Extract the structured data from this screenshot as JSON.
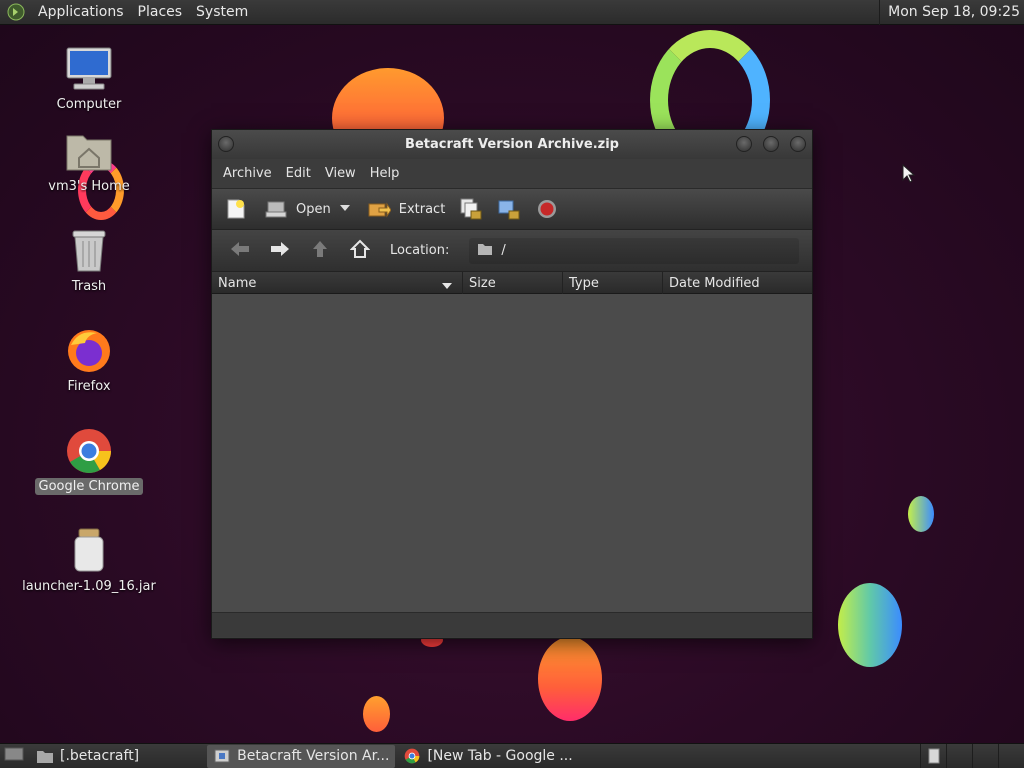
{
  "top_panel": {
    "menus": [
      "Applications",
      "Places",
      "System"
    ],
    "clock": "Mon Sep 18, 09:25"
  },
  "desktop_icons": [
    {
      "label": "Computer",
      "icon": "computer-icon"
    },
    {
      "label": "vm3's Home",
      "icon": "home-folder-icon"
    },
    {
      "label": "Trash",
      "icon": "trash-icon"
    },
    {
      "label": "Firefox",
      "icon": "firefox-icon"
    },
    {
      "label": "Google Chrome",
      "icon": "chrome-icon",
      "selected": true
    },
    {
      "label": "launcher-1.09_16.jar",
      "icon": "jar-icon"
    }
  ],
  "window": {
    "title": "Betacraft Version Archive.zip",
    "menu": [
      "Archive",
      "Edit",
      "View",
      "Help"
    ],
    "toolbar": {
      "open_label": "Open",
      "extract_label": "Extract"
    },
    "location": {
      "label": "Location:",
      "path": "/"
    },
    "columns": {
      "name": "Name",
      "size": "Size",
      "type": "Type",
      "date": "Date Modified"
    },
    "files": []
  },
  "taskbar": {
    "tasks": [
      {
        "label": "[.betacraft]",
        "icon": "folder-icon",
        "active": false
      },
      {
        "label": "Betacraft Version Ar...",
        "icon": "archive-manager-icon",
        "active": true
      },
      {
        "label": "[New Tab - Google ...",
        "icon": "chrome-icon",
        "active": false
      }
    ]
  },
  "colors": {
    "accent_orange": "#ff7a2e",
    "accent_green": "#9be35b",
    "accent_blue": "#3b8cff",
    "window_bg": "#3c3c3c",
    "list_bg": "#4b4b4b"
  }
}
